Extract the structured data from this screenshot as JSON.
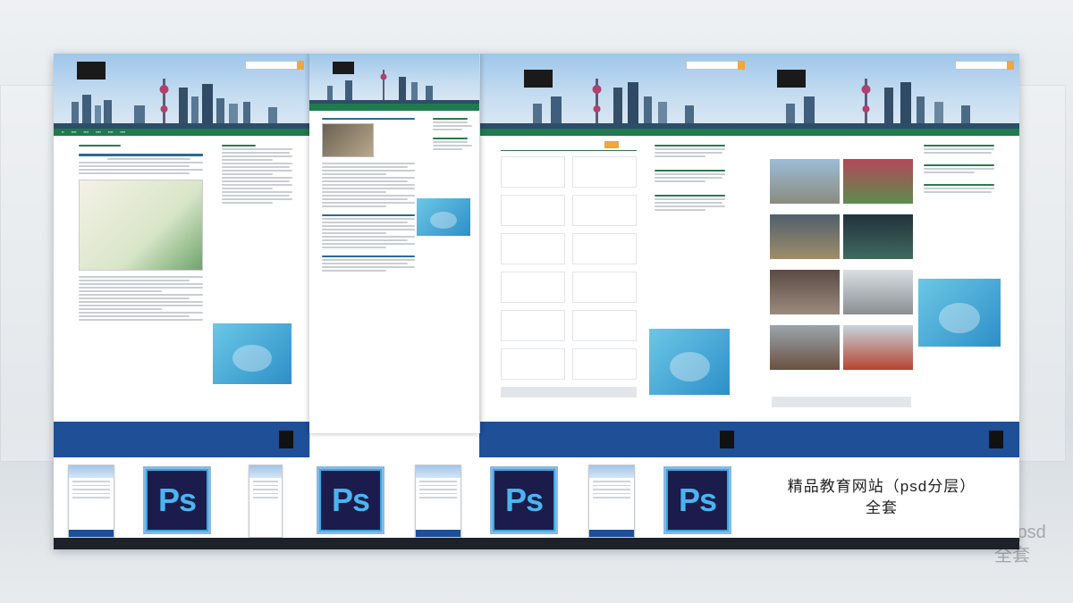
{
  "title": {
    "line1": "精品教育网站（psd分层）",
    "line2": "全套"
  },
  "background_ghost": {
    "line1": "（ psd",
    "line2": "全套"
  },
  "ps_icon_label": "Ps",
  "thumbnails": [
    {
      "kind": "page-preview"
    },
    {
      "kind": "ps-icon"
    },
    {
      "kind": "page-preview"
    },
    {
      "kind": "ps-icon"
    },
    {
      "kind": "page-preview"
    },
    {
      "kind": "ps-icon"
    },
    {
      "kind": "page-preview"
    },
    {
      "kind": "ps-icon"
    }
  ],
  "colors": {
    "nav_green": "#1f7a4e",
    "footer_blue": "#1e4f97",
    "accent_orange": "#f0a73c",
    "ps_blue": "#49b5f0",
    "ps_dark": "#1b1c4b"
  }
}
